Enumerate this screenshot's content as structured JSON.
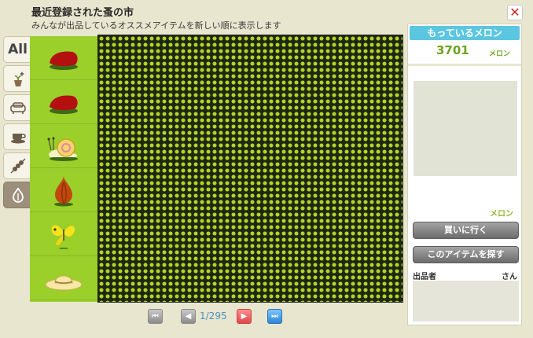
{
  "header": {
    "title": "最近登録された蚤の市",
    "subtitle": "みんなが出品しているオススメアイテムを新しい順に表示します",
    "close_label": "✕"
  },
  "categories": [
    {
      "label": "All",
      "icon": "all-icon"
    },
    {
      "label": "",
      "icon": "plant-sparkle-icon"
    },
    {
      "label": "",
      "icon": "sofa-icon"
    },
    {
      "label": "",
      "icon": "teacup-icon"
    },
    {
      "label": "",
      "icon": "skewer-icon"
    },
    {
      "label": "",
      "icon": "onion-icon",
      "active": true
    }
  ],
  "items": [
    {
      "name": "red-cushion-item"
    },
    {
      "name": "red-cushion-item"
    },
    {
      "name": "snail-item"
    },
    {
      "name": "onion-item"
    },
    {
      "name": "yellow-butterfly-item"
    },
    {
      "name": "straw-hat-item"
    }
  ],
  "pager": {
    "page_text": "1/295"
  },
  "right_panel": {
    "melon_header": "もっているメロン",
    "melon_count": "3701",
    "melon_unit": "メロン",
    "price_unit": "メロン",
    "buy_button": "買いに行く",
    "find_button": "このアイテムを探す",
    "seller_label": "出品者",
    "seller_suffix": "さん"
  },
  "colors": {
    "accent_cyan": "#5bc6e0",
    "melon_green": "#6aa41e",
    "item_column_green": "#9bcf2a"
  }
}
